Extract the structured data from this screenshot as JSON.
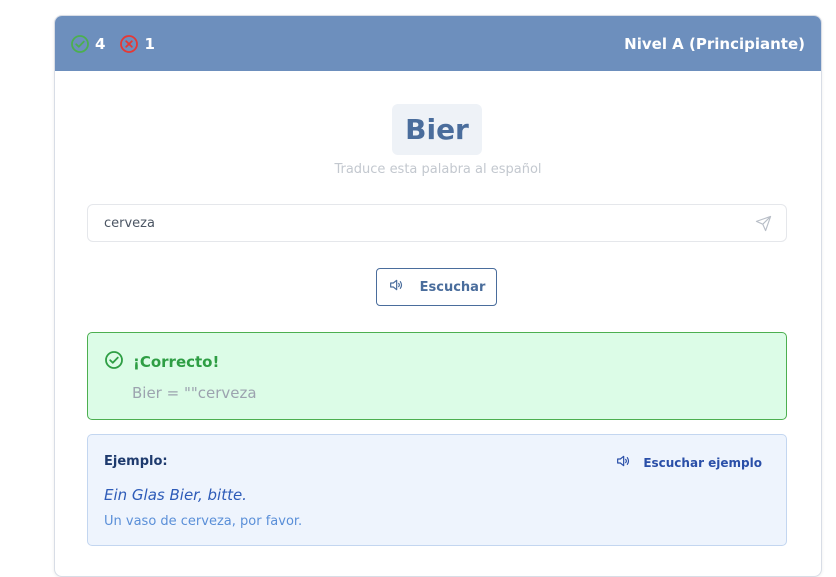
{
  "header": {
    "correct_count": "4",
    "wrong_count": "1",
    "level": "Nivel A (Principiante)",
    "correct_icon": "check-circle-icon",
    "wrong_icon": "x-circle-icon"
  },
  "quiz": {
    "word": "Bier",
    "instruction": "Traduce esta palabra al español",
    "answer_value": "cerveza",
    "listen_label": "Escuchar"
  },
  "feedback": {
    "title": "¡Correcto!",
    "detail": "Bier = \"\"cerveza"
  },
  "example": {
    "label": "Ejemplo:",
    "listen_label": "Escuchar ejemplo",
    "sentence": "Ein Glas Bier, bitte.",
    "translation": "Un vaso de cerveza, por favor."
  },
  "colors": {
    "header_bg": "#6d8fbd",
    "accent": "#4a6d9c",
    "success": "#2e9e44",
    "error": "#e53935",
    "example_text": "#2d5bb8"
  }
}
